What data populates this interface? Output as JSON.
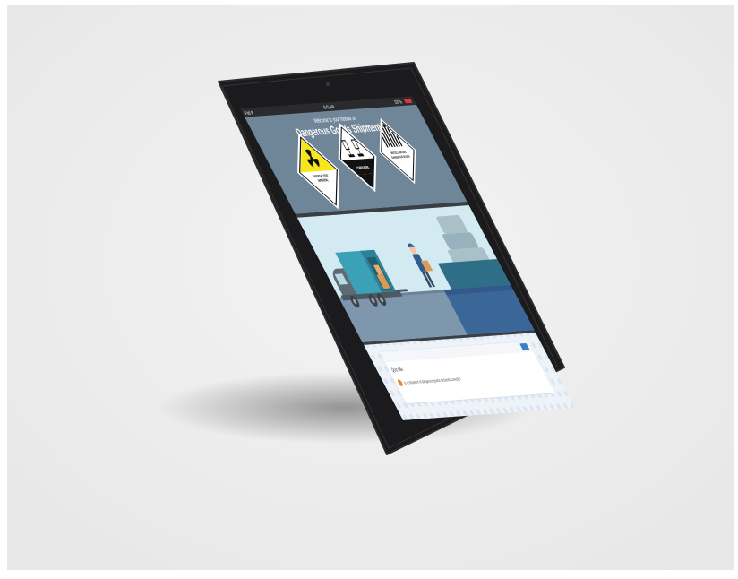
{
  "screen": {
    "status_bar": {
      "carrier": "iPad ⊛",
      "time": "9:41 AM",
      "battery": "100%"
    },
    "hero": {
      "welcome_text": "Welcome to your module on",
      "title": "Dangerous Goods Shipments"
    },
    "placards": [
      {
        "label_line1": "RADIOACTIVE",
        "label_line2": "MATERIAL",
        "icon": "radioactive-icon",
        "color": "#f6e61a"
      },
      {
        "label_line1": "CORROSIVE",
        "label_line2": "",
        "icon": "corrosive-icon",
        "color": "#ffffff"
      },
      {
        "label_line1": "MISCELLANEOUS",
        "label_line2": "DANGEROUS GOODS",
        "icon": "miscellaneous-icon",
        "color": "#ffffff"
      }
    ],
    "quiz": {
      "heading": "Quiz title",
      "question": "Is a shipment of dangerous goods declared correctly?"
    }
  },
  "colors": {
    "background": "#ececec",
    "tablet_frame": "#1b1b1d",
    "hero_bg": "#6f8598",
    "scene_bg": "#d3eaf3",
    "floor": "#7f97ad",
    "accent": "#e8892b"
  }
}
